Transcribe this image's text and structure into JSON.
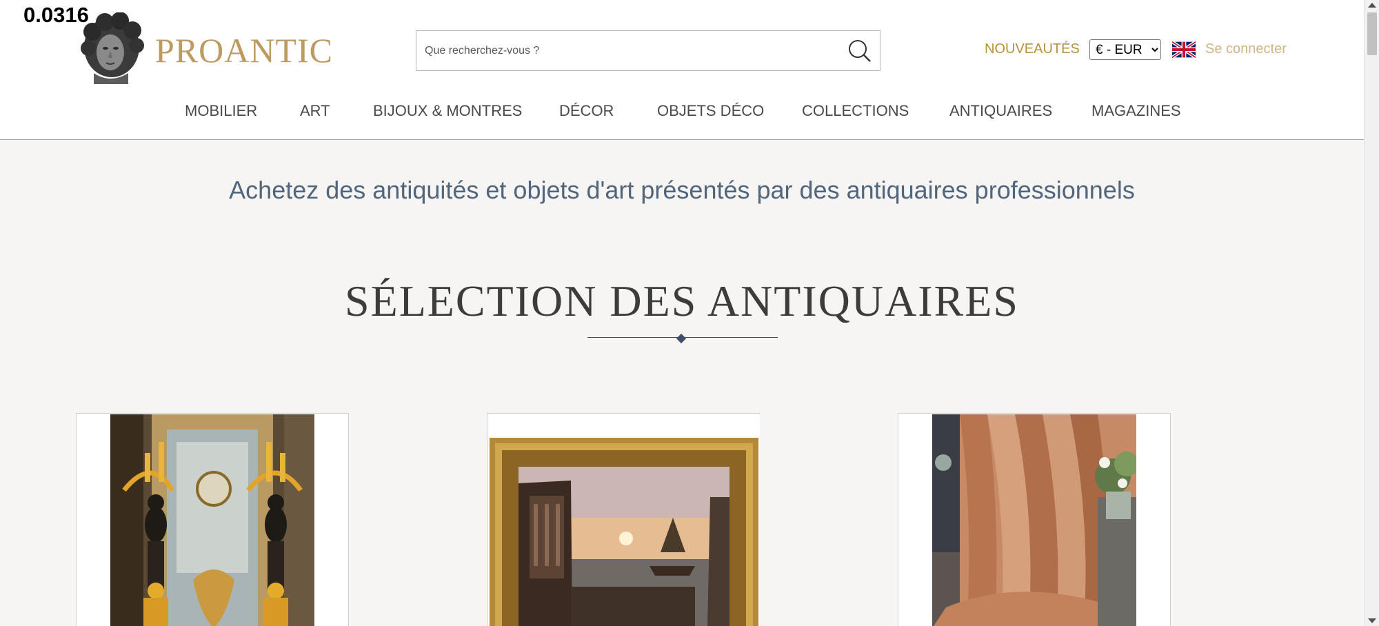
{
  "debug": {
    "value": "0.0316"
  },
  "header": {
    "logo_text": "PROANTIC",
    "logo_icon": "classical-bust-icon",
    "search": {
      "placeholder": "Que recherchez-vous ?",
      "value": "",
      "icon": "search-icon"
    },
    "new_arrivals": "NOUVEAUTÉS",
    "currency": {
      "selected": "€ - EUR"
    },
    "language_flag": "uk-flag-icon",
    "login": "Se connecter"
  },
  "nav": {
    "items": [
      {
        "label": "MOBILIER"
      },
      {
        "label": "ART"
      },
      {
        "label": "BIJOUX & MONTRES"
      },
      {
        "label": "DÉCOR"
      },
      {
        "label": "OBJETS DÉCO"
      },
      {
        "label": "COLLECTIONS"
      },
      {
        "label": "ANTIQUAIRES"
      },
      {
        "label": "MAGAZINES"
      }
    ]
  },
  "main": {
    "tagline": "Achetez des antiquités et objets d'art présentés par des antiquaires professionnels",
    "section_title": "SÉLECTION DES ANTIQUAIRES",
    "cards": [
      {
        "image": "gilt-bronze-candelabra-image"
      },
      {
        "image": "harbor-landscape-painting-image"
      },
      {
        "image": "silk-curtains-image"
      }
    ]
  },
  "colors": {
    "brand_gold": "#bd9a5f",
    "accent_gold": "#b8913c",
    "login_gold": "#cfb485",
    "tagline_blue": "#51657c",
    "background": "#f6f5f3"
  }
}
